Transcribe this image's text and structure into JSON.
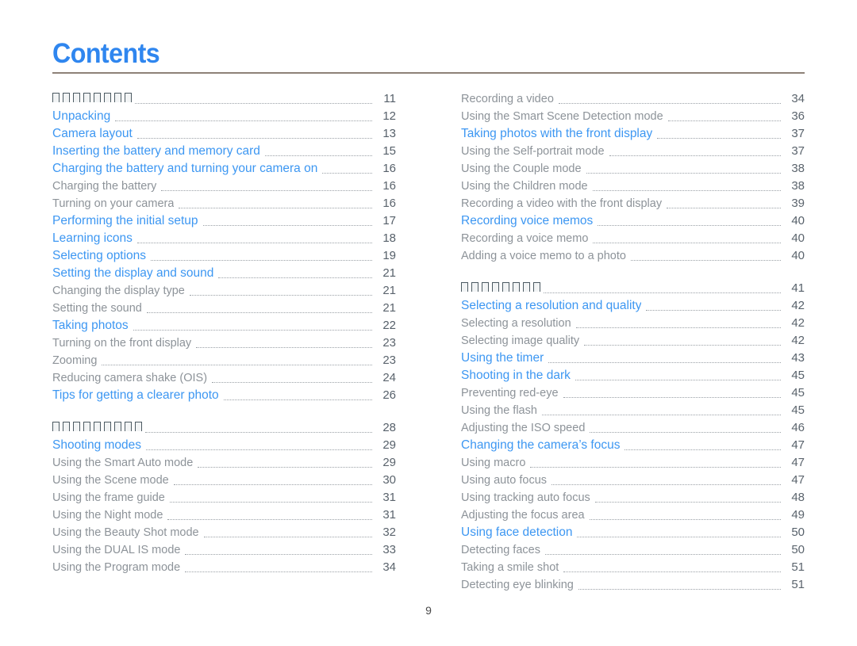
{
  "document": {
    "title": "Contents",
    "folio": "9",
    "accent_blue": "#3d97f2",
    "title_blue": "#2f86ef",
    "rule_color": "#8d8178",
    "level2_gray": "#8d9399",
    "page_number_color": "#56606a"
  },
  "left_column": {
    "sections": [
      {
        "entries": [
          {
            "label": "□ □ □ □ □ □ □ □",
            "tofu_count": 8,
            "page": "11",
            "level": 1,
            "missing_glyphs": true
          },
          {
            "label": "Unpacking",
            "page": "12",
            "level": 1
          },
          {
            "label": "Camera layout",
            "page": "13",
            "level": 1
          },
          {
            "label": "Inserting the battery and memory card",
            "page": "15",
            "level": 1
          },
          {
            "label": "Charging the battery and turning your camera on",
            "page": "16",
            "level": 1
          },
          {
            "label": "Charging the battery",
            "page": "16",
            "level": 2
          },
          {
            "label": "Turning on your camera",
            "page": "16",
            "level": 2
          },
          {
            "label": "Performing the initial setup",
            "page": "17",
            "level": 1
          },
          {
            "label": "Learning icons",
            "page": "18",
            "level": 1
          },
          {
            "label": "Selecting options",
            "page": "19",
            "level": 1
          },
          {
            "label": "Setting the display and sound",
            "page": "21",
            "level": 1
          },
          {
            "label": "Changing the display type",
            "page": "21",
            "level": 2
          },
          {
            "label": "Setting the sound",
            "page": "21",
            "level": 2
          },
          {
            "label": "Taking photos",
            "page": "22",
            "level": 1
          },
          {
            "label": "Turning on the front display",
            "page": "23",
            "level": 2
          },
          {
            "label": "Zooming",
            "page": "23",
            "level": 2
          },
          {
            "label": "Reducing camera shake (OIS)",
            "page": "24",
            "level": 2
          },
          {
            "label": "Tips for getting a clearer photo",
            "page": "26",
            "level": 1
          }
        ]
      },
      {
        "entries": [
          {
            "label": "□ □ □ □ □ □ □ □ □",
            "tofu_count": 9,
            "page": "28",
            "level": 1,
            "missing_glyphs": true
          },
          {
            "label": "Shooting modes",
            "page": "29",
            "level": 1
          },
          {
            "label": "Using the Smart Auto mode",
            "page": "29",
            "level": 2
          },
          {
            "label": "Using the Scene mode",
            "page": "30",
            "level": 2
          },
          {
            "label": "Using the frame guide",
            "page": "31",
            "level": 2
          },
          {
            "label": "Using the Night mode",
            "page": "31",
            "level": 2
          },
          {
            "label": "Using the Beauty Shot mode",
            "page": "32",
            "level": 2
          },
          {
            "label": "Using the DUAL IS mode",
            "page": "33",
            "level": 2
          },
          {
            "label": "Using the Program mode",
            "page": "34",
            "level": 2
          }
        ]
      }
    ]
  },
  "right_column": {
    "sections": [
      {
        "entries": [
          {
            "label": "Recording a video",
            "page": "34",
            "level": 2
          },
          {
            "label": "Using the Smart Scene Detection mode",
            "page": "36",
            "level": 2
          },
          {
            "label": "Taking photos with the front display",
            "page": "37",
            "level": 1
          },
          {
            "label": "Using the Self-portrait mode",
            "page": "37",
            "level": 2
          },
          {
            "label": "Using the Couple mode",
            "page": "38",
            "level": 2
          },
          {
            "label": "Using the Children mode",
            "page": "38",
            "level": 2
          },
          {
            "label": "Recording a video with the front display",
            "page": "39",
            "level": 2
          },
          {
            "label": "Recording voice memos",
            "page": "40",
            "level": 1
          },
          {
            "label": "Recording a voice memo",
            "page": "40",
            "level": 2
          },
          {
            "label": "Adding a voice memo to a photo",
            "page": "40",
            "level": 2
          }
        ]
      },
      {
        "entries": [
          {
            "label": "□ □ □ □ □ □ □ □",
            "tofu_count": 8,
            "page": "41",
            "level": 1,
            "missing_glyphs": true
          },
          {
            "label": "Selecting a resolution and quality",
            "page": "42",
            "level": 1
          },
          {
            "label": "Selecting a resolution",
            "page": "42",
            "level": 2
          },
          {
            "label": "Selecting image quality",
            "page": "42",
            "level": 2
          },
          {
            "label": "Using the timer",
            "page": "43",
            "level": 1
          },
          {
            "label": "Shooting in the dark",
            "page": "45",
            "level": 1
          },
          {
            "label": "Preventing red-eye",
            "page": "45",
            "level": 2
          },
          {
            "label": "Using the flash",
            "page": "45",
            "level": 2
          },
          {
            "label": "Adjusting the ISO speed",
            "page": "46",
            "level": 2
          },
          {
            "label": "Changing the camera’s focus",
            "page": "47",
            "level": 1
          },
          {
            "label": "Using macro",
            "page": "47",
            "level": 2
          },
          {
            "label": "Using auto focus",
            "page": "47",
            "level": 2
          },
          {
            "label": "Using tracking auto focus",
            "page": "48",
            "level": 2
          },
          {
            "label": "Adjusting the focus area",
            "page": "49",
            "level": 2
          },
          {
            "label": "Using face detection",
            "page": "50",
            "level": 1
          },
          {
            "label": "Detecting faces",
            "page": "50",
            "level": 2
          },
          {
            "label": "Taking a smile shot",
            "page": "51",
            "level": 2
          },
          {
            "label": "Detecting eye blinking",
            "page": "51",
            "level": 2
          }
        ]
      }
    ]
  }
}
